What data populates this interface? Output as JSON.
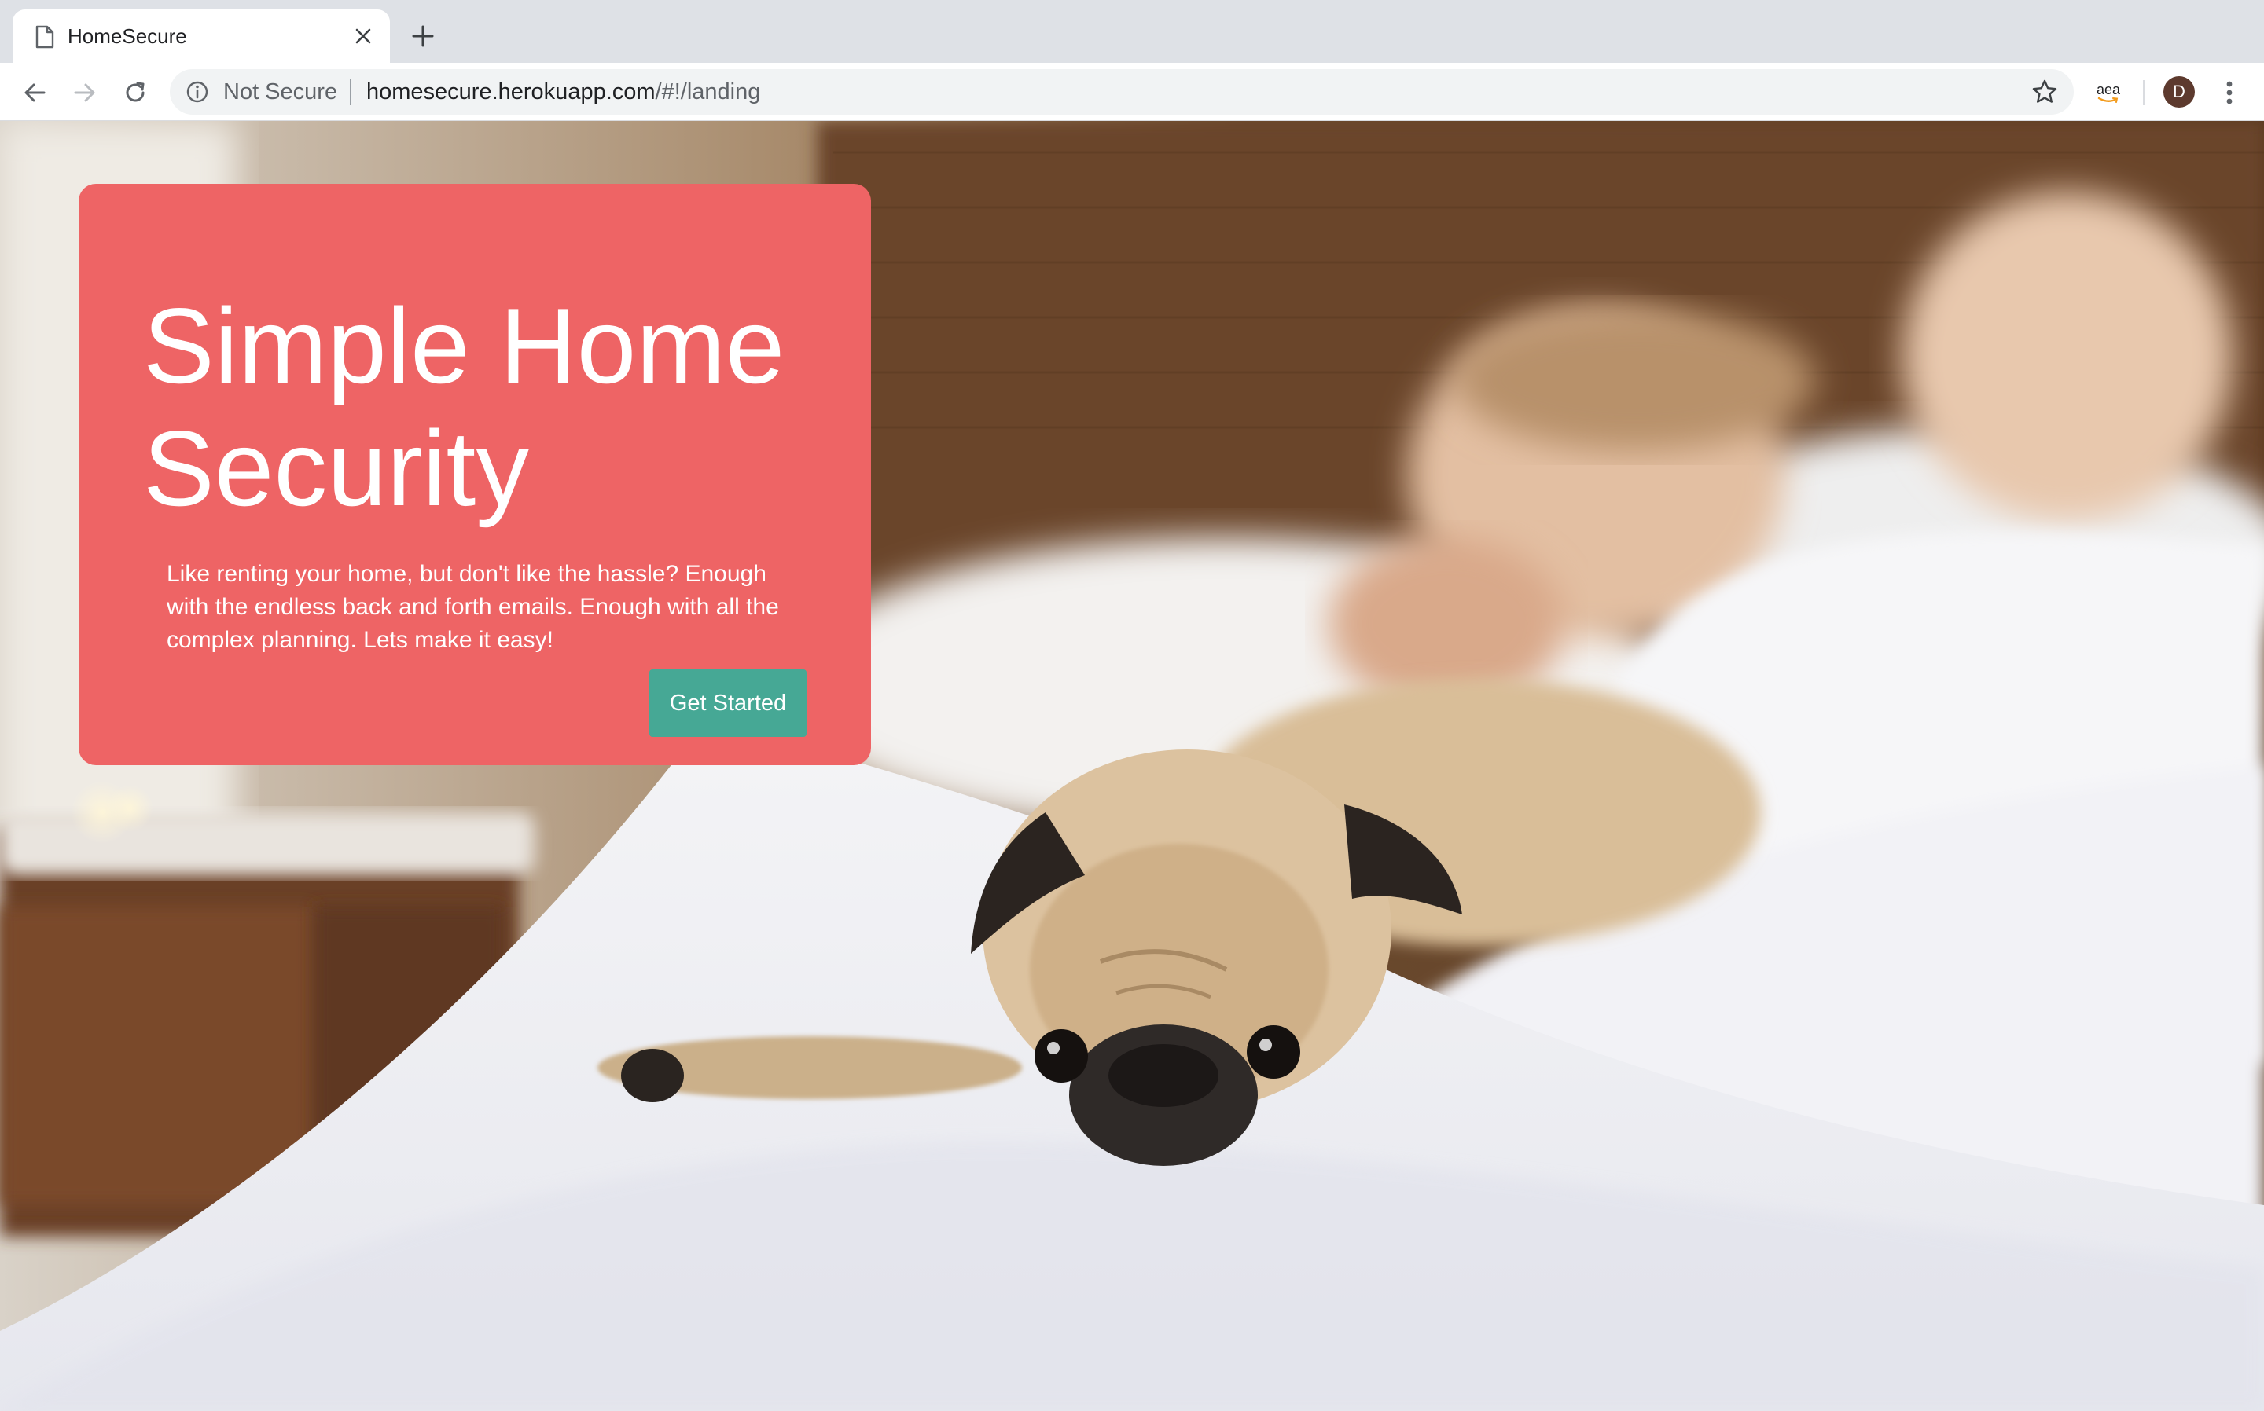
{
  "browser": {
    "tab": {
      "title": "HomeSecure"
    },
    "security_label": "Not Secure",
    "url": {
      "host": "homesecure.herokuapp.com",
      "path": "/#!/landing"
    },
    "extension_label": "aea",
    "profile_initial": "D"
  },
  "hero": {
    "title": "Simple Home Security",
    "description": "Like renting your home, but don't like the hassle? Enough with the endless back and forth emails. Enough with all the complex planning. Lets make it easy!",
    "cta_label": "Get Started",
    "card_color": "#ee6465",
    "button_color": "#46a895"
  },
  "background_image": {
    "subject": "pug-and-sleeping-woman-on-bed-photo"
  }
}
